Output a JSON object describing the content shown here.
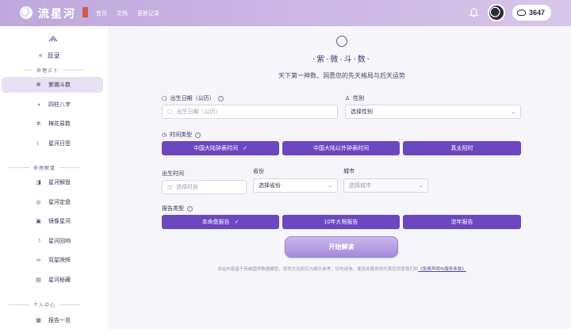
{
  "header": {
    "logo_text": "流星河",
    "nav": [
      "首页",
      "文档",
      "更新记录"
    ],
    "coins": "3647"
  },
  "sidebar": {
    "toggle_label": "目录",
    "toggle_arrow": "«",
    "sections": [
      {
        "title": "命理占卜",
        "items": [
          "紫微斗数",
          "四柱八字",
          "梅花易数",
          "星河日签"
        ]
      },
      {
        "title": "命理解盘",
        "items": [
          "星河解盘",
          "星河定盘",
          "镜像星河",
          "星河回响",
          "双星映辉",
          "星河秘藏"
        ]
      },
      {
        "title": "个人中心",
        "items": [
          "报告一览"
        ]
      }
    ]
  },
  "main": {
    "brand": "·紫·微·斗·数·",
    "subtitle": "天下第一神数、洞悉您的先天格局与后天运势",
    "birth_date_label": "出生日期（公历）",
    "birth_date_placeholder": "出生日期（公历）",
    "gender_label": "性别",
    "gender_value": "选择性别",
    "time_type_label": "时间类型",
    "time_type_options": [
      "中国大陆钟表时间",
      "中国大陆以外钟表时间",
      "真太阳时"
    ],
    "time_type_selected_mark": "✓",
    "birth_time_label": "出生时间",
    "birth_time_placeholder": "选择时辰",
    "province_label": "省份",
    "province_value": "选择省份",
    "city_label": "城市",
    "city_placeholder": "选择城市",
    "report_type_label": "报告类型",
    "report_type_options": [
      "本命盘报告",
      "10年大限报告",
      "流年报告"
    ],
    "report_selected_mark": "✓",
    "start_button": "开始解读",
    "disclaimer_text": "本站内容基于传统国学数据模型，仅供文化研究与娱乐参考，切勿迷信。使用本服务即代表您同意我们的",
    "disclaimer_link": "《免责声明与服务条款》"
  }
}
